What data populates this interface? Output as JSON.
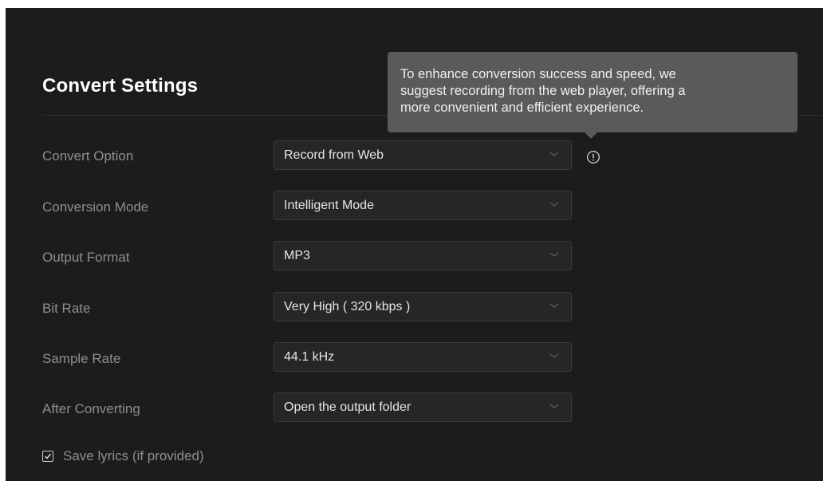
{
  "title": "Convert Settings",
  "tooltip": {
    "line1": "To enhance conversion success and speed, we",
    "line2": "suggest recording from the web player, offering a",
    "line3": "more convenient and efficient experience."
  },
  "settings": [
    {
      "label": "Convert Option",
      "value": "Record from Web"
    },
    {
      "label": "Conversion Mode",
      "value": "Intelligent Mode"
    },
    {
      "label": "Output Format",
      "value": "MP3"
    },
    {
      "label": "Bit Rate",
      "value": "Very High ( 320 kbps )"
    },
    {
      "label": "Sample Rate",
      "value": "44.1 kHz"
    },
    {
      "label": "After Converting",
      "value": "Open the output folder"
    }
  ],
  "save_lyrics": {
    "label": "Save lyrics (if provided)",
    "checked": true
  },
  "icons": {
    "info": "info-circle-icon",
    "dropdown": "chevron-down-icon",
    "checkbox": "checkmark-icon"
  },
  "colors": {
    "background": "#1c1c1c",
    "field_background": "#262626",
    "tooltip_background": "#5a5a5a",
    "label_text": "#8e8e8e",
    "value_text": "#e6e6e6"
  }
}
